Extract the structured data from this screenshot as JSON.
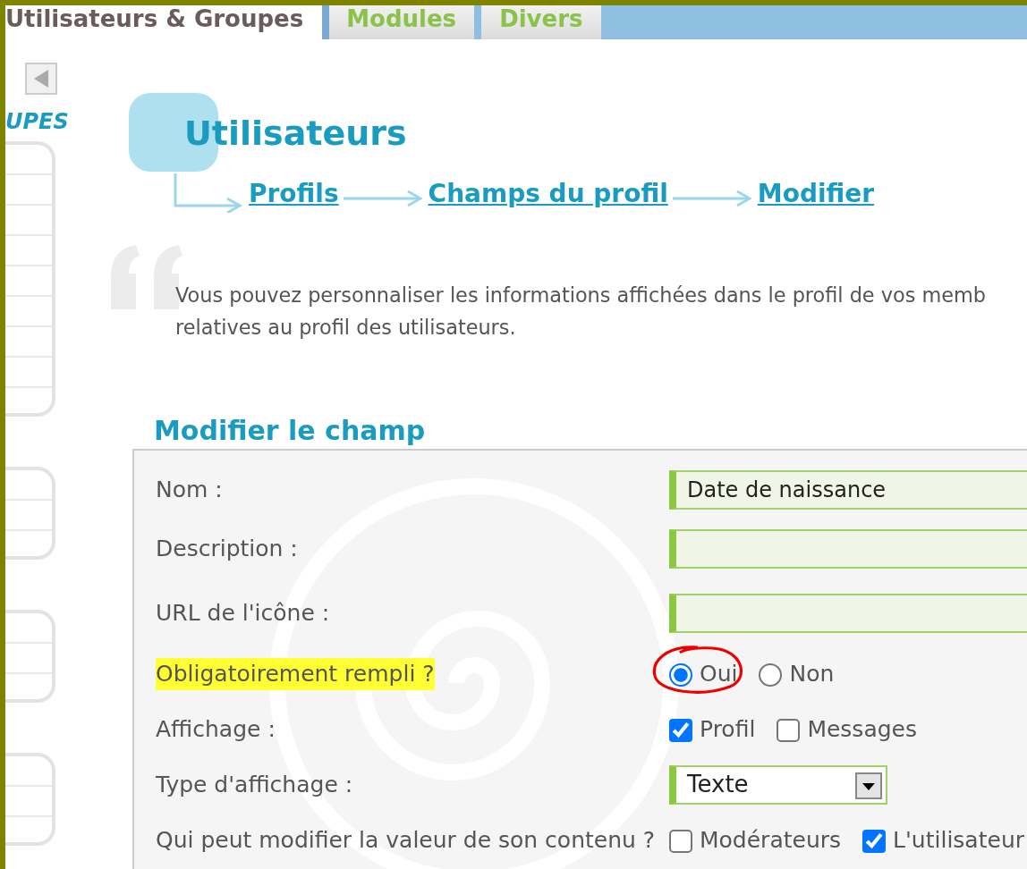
{
  "tabs": [
    {
      "label": "Utilisateurs & Groupes",
      "selected": true
    },
    {
      "label": "Modules",
      "selected": false
    },
    {
      "label": "Divers",
      "selected": false
    }
  ],
  "sidebar": {
    "heading": "UPES"
  },
  "page": {
    "title": "Utilisateurs",
    "breadcrumb": [
      "Profils",
      "Champs du profil",
      "Modifier"
    ],
    "intro": [
      "Vous pouvez personnaliser les informations affichées dans le profil de vos memb",
      "relatives au profil des utilisateurs."
    ]
  },
  "form": {
    "legend": "Modifier le champ",
    "rows": [
      {
        "label": "Nom :",
        "kind": "text",
        "value": "Date de naissance",
        "highlighted": false
      },
      {
        "label": "Description :",
        "kind": "text",
        "value": "",
        "highlighted": false
      },
      {
        "label": "URL de l'icône :",
        "kind": "text",
        "value": "",
        "highlighted": false
      },
      {
        "label": "Obligatoirement rempli ?",
        "kind": "radio",
        "highlighted": true,
        "options": [
          {
            "label": "Oui",
            "selected": true,
            "circled": true
          },
          {
            "label": "Non",
            "selected": false,
            "circled": false
          }
        ]
      },
      {
        "label": "Affichage :",
        "kind": "checkbox",
        "highlighted": false,
        "options": [
          {
            "label": "Profil",
            "checked": true
          },
          {
            "label": "Messages",
            "checked": false
          }
        ]
      },
      {
        "label": "Type d'affichage :",
        "kind": "select",
        "value": "Texte",
        "highlighted": false
      },
      {
        "label": "Qui peut modifier la valeur de son contenu ?",
        "kind": "checkbox",
        "highlighted": false,
        "options": [
          {
            "label": "Modérateurs",
            "checked": false
          },
          {
            "label": "L'utilisateur",
            "checked": true
          }
        ]
      }
    ]
  }
}
